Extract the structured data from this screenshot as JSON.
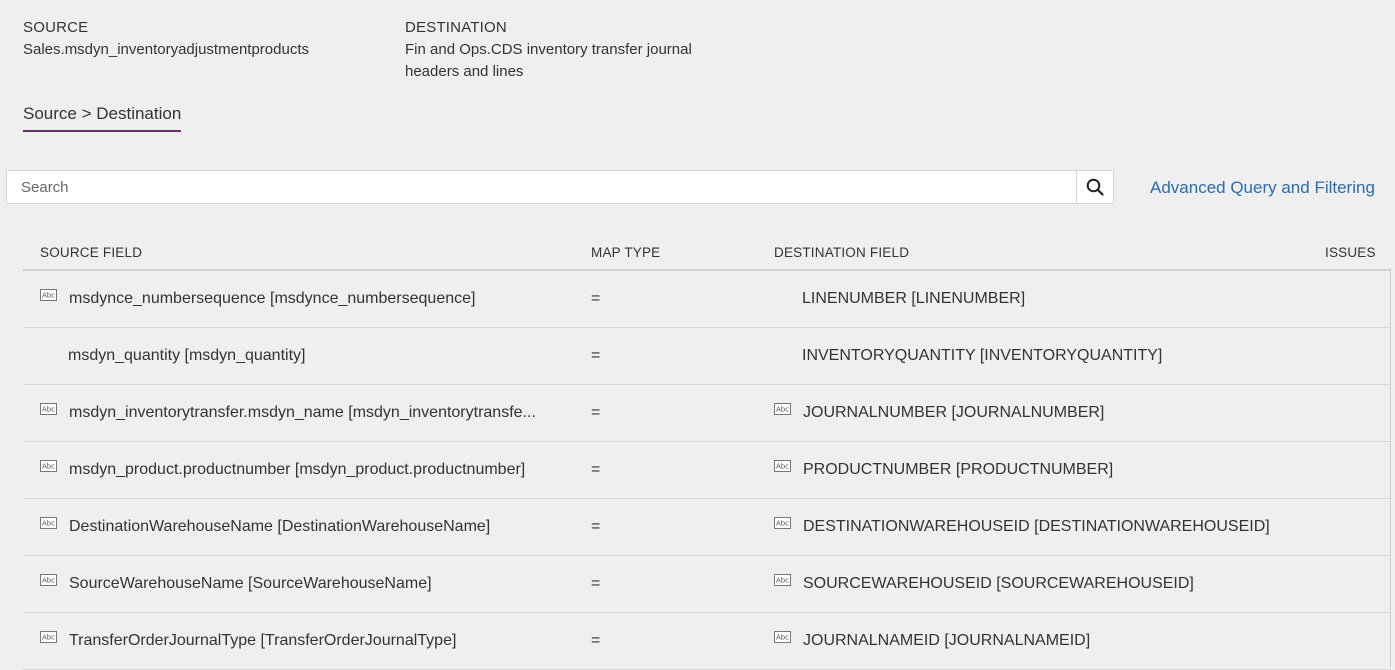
{
  "header": {
    "source_label": "SOURCE",
    "source_value": "Sales.msdyn_inventoryadjustmentproducts",
    "destination_label": "DESTINATION",
    "destination_value": "Fin and Ops.CDS inventory transfer journal headers and lines"
  },
  "tab": {
    "label": "Source > Destination"
  },
  "search": {
    "placeholder": "Search"
  },
  "advanced_link": "Advanced Query and Filtering",
  "columns": {
    "source": "SOURCE FIELD",
    "map_type": "MAP TYPE",
    "destination": "DESTINATION FIELD",
    "issues": "ISSUES"
  },
  "rows": [
    {
      "source": "msdynce_numbersequence [msdynce_numbersequence]",
      "source_icon": "text-field-icon",
      "map": "=",
      "destination": "LINENUMBER [LINENUMBER]",
      "destination_icon": ""
    },
    {
      "source": "msdyn_quantity [msdyn_quantity]",
      "source_icon": "",
      "map": "=",
      "destination": "INVENTORYQUANTITY [INVENTORYQUANTITY]",
      "destination_icon": ""
    },
    {
      "source": "msdyn_inventorytransfer.msdyn_name [msdyn_inventorytransfe...",
      "source_icon": "text-field-icon",
      "map": "=",
      "destination": "JOURNALNUMBER [JOURNALNUMBER]",
      "destination_icon": "text-field-icon"
    },
    {
      "source": "msdyn_product.productnumber [msdyn_product.productnumber]",
      "source_icon": "text-field-icon",
      "map": "=",
      "destination": "PRODUCTNUMBER [PRODUCTNUMBER]",
      "destination_icon": "text-field-icon"
    },
    {
      "source": "DestinationWarehouseName [DestinationWarehouseName]",
      "source_icon": "text-field-icon",
      "map": "=",
      "destination": "DESTINATIONWAREHOUSEID [DESTINATIONWAREHOUSEID]",
      "destination_icon": "text-field-icon"
    },
    {
      "source": "SourceWarehouseName [SourceWarehouseName]",
      "source_icon": "text-field-icon",
      "map": "=",
      "destination": "SOURCEWAREHOUSEID [SOURCEWAREHOUSEID]",
      "destination_icon": "text-field-icon"
    },
    {
      "source": "TransferOrderJournalType [TransferOrderJournalType]",
      "source_icon": "text-field-icon",
      "map": "=",
      "destination": "JOURNALNAMEID [JOURNALNAMEID]",
      "destination_icon": "text-field-icon"
    }
  ],
  "colors": {
    "tab_underline": "#6b2c6e",
    "link": "#2b6cb0",
    "background": "#efefef"
  }
}
